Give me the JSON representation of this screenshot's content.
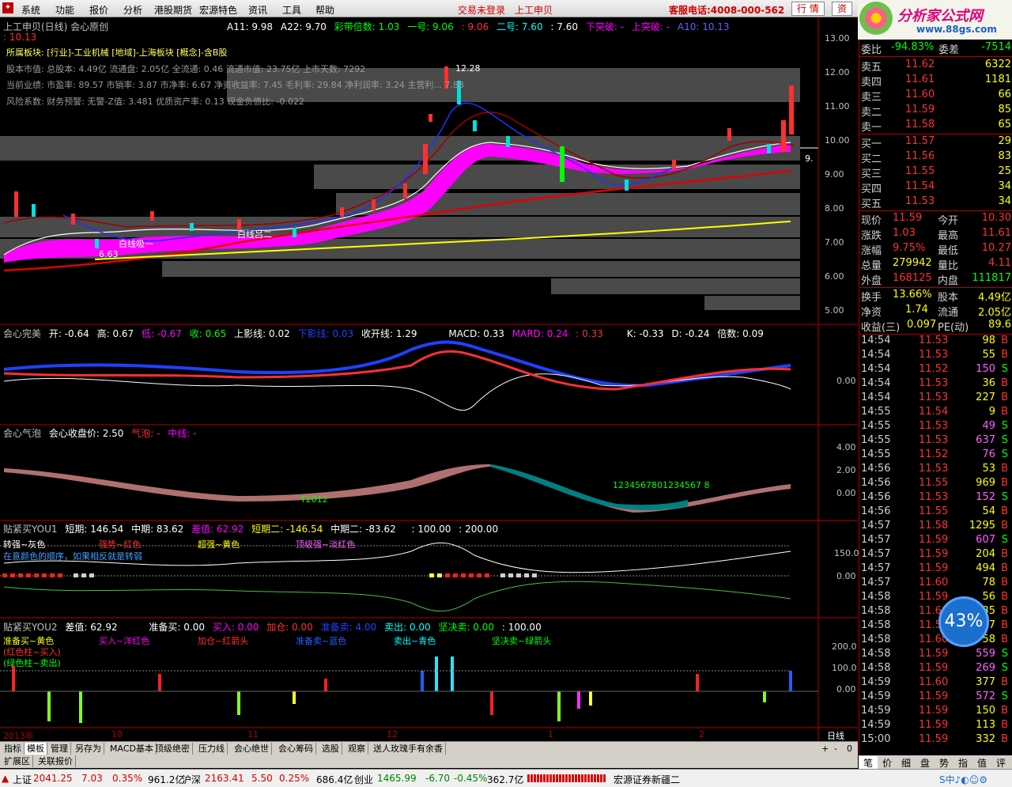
{
  "menu": {
    "items": [
      "系统",
      "功能",
      "报价",
      "分析",
      "港股期货",
      "宏源特色",
      "资讯",
      "工具",
      "帮助"
    ],
    "login": "交易未登录",
    "stock": "上工申贝",
    "hotline": "客服电话:4008-000-562",
    "btn1": "行 情",
    "btn2": "资"
  },
  "brand": {
    "title": "分析家公式网",
    "url": "www.88gs.com"
  },
  "main": {
    "title": "上工申贝(日线) 会心原创",
    "a11": "A11: 9.98",
    "a22": "A22: 9.70",
    "caidai": "彩带倍数: 1.03",
    "yihao": "一号: 9.06",
    "yihao2": ": 9.06",
    "erhao": "二号: 7.60",
    "erhao2": ": 7.60",
    "xiatupo": "下突破: -",
    "shangtupo": "上突破: -",
    "a10": "A10: 10.13",
    "val1013": ": 10.13",
    "info1": "所属板块: [行业]-工业机械 [地域]-上海板块 [概念]-含B股",
    "info2": "股本市值: 总股本: 4.49亿 流通盘: 2.05亿 全流通: 0.46 流通市值: 23.75亿 上市天数: 7292",
    "info3": "当前业绩: 市盈率: 89.57 市销率: 3.87 市净率: 6.67 净资收益率: 7.45 毛利率: 29.84 净利润率: 3.24 主营利... 7.88",
    "info4": "风险系数: 财务预警: 无警-Z值: 3.481 优质资产率: 0.13 现金负债比: -0.022",
    "hi": "12.28",
    "lo": "6.63",
    "ann1": "白线吸一",
    "ann2": "白线吕二",
    "lastprice": "9.",
    "yaxis": [
      "13.00",
      "12.00",
      "11.00",
      "10.00",
      "9.00",
      "8.00",
      "7.00",
      "6.00",
      "5.00"
    ]
  },
  "p2": {
    "name": "会心完美",
    "kai": "开: -0.64",
    "gao": "高: 0.67",
    "di": "低: -0.67",
    "shou": "收: 0.65",
    "syx": "上影线: 0.02",
    "xyx": "下影线: 0.03",
    "skx": "收开线: 1.29",
    "macd": "MACD: 0.33",
    "mard": "MARD: 0.24",
    "v033": ": 0.33",
    "k": "K: -0.33",
    "d": "D: -0.24",
    "bs": "倍数: 0.09",
    "y0": "0.00"
  },
  "p3": {
    "name": "会心气泡",
    "close": "会心收盘价: 2.50",
    "qp": "气泡: -",
    "zx": "中线: -",
    "y": [
      "4.00",
      "2.00",
      "0.00"
    ],
    "seq1": "T2012",
    "seq2": "1234567801234567 8"
  },
  "p4": {
    "name": "贴紧买YOU1",
    "dq": "短期: 146.54",
    "zq": "中期: 83.62",
    "cz": "差值: 62.92",
    "dq2": "短期二: -146.54",
    "zq2": "中期二: -83.62",
    "c100": ": 100.00",
    "c200": ": 200.00",
    "l1": "转强~灰色",
    "l2": "强势~红色",
    "l3": "超强~黄色",
    "l4": "顶级强~淡红色",
    "l5": "在意颜色的顺序，如果相反就是转弱",
    "y": [
      "150.0",
      "0.00"
    ]
  },
  "p5": {
    "name": "贴紧买YOU2",
    "cz": "差值: 62.92",
    "zbm": "准备买: 0.00",
    "mr": "买入: 0.00",
    "jc": "加仓: 0.00",
    "zbmc": "准备卖: 4.00",
    "mc": "卖出: 0.00",
    "jjm": "坚决卖: 0.00",
    "c100": ": 100.00",
    "l1": "准备买~黄色",
    "l2": "买入~洋红色",
    "l3": "加仓~红箭头",
    "l4": "准备卖~蓝色",
    "l5": "卖出~青色",
    "l6": "坚决卖~绿箭头",
    "l7": "(红色柱~买入)",
    "l8": "(绿色柱~卖出)",
    "y": [
      "200.0",
      "100.0",
      "0.00"
    ]
  },
  "xaxis": {
    "labels": [
      "2013年",
      "10",
      "11",
      "12",
      "1",
      "2"
    ],
    "mode": "日线"
  },
  "tabs": [
    "指标",
    "模板",
    "管理",
    "另存为",
    "MACD基本",
    "顶级绝密",
    "压力线",
    "会心绝世",
    "会心筹码",
    "选股",
    "观察",
    "送人玫瑰手有余香"
  ],
  "subtabs": [
    "扩展区",
    "关联报价"
  ],
  "quote": {
    "wb": "委比",
    "wbv": "-94.83%",
    "wc": "委差",
    "wcv": "-7514",
    "sell": [
      [
        "卖五",
        "11.62",
        "6322"
      ],
      [
        "卖四",
        "11.61",
        "1181"
      ],
      [
        "卖三",
        "11.60",
        "66"
      ],
      [
        "卖二",
        "11.59",
        "85"
      ],
      [
        "卖一",
        "11.58",
        "65"
      ]
    ],
    "buy": [
      [
        "买一",
        "11.57",
        "29"
      ],
      [
        "买二",
        "11.56",
        "83"
      ],
      [
        "买三",
        "11.55",
        "25"
      ],
      [
        "买四",
        "11.54",
        "34"
      ],
      [
        "买五",
        "11.53",
        "34"
      ]
    ],
    "stats": [
      [
        "现价",
        "11.59",
        "今开",
        "10.30"
      ],
      [
        "涨跌",
        "1.03",
        "最高",
        "11.61"
      ],
      [
        "涨幅",
        "9.75%",
        "最低",
        "10.27"
      ],
      [
        "总量",
        "279942",
        "量比",
        "4.11"
      ],
      [
        "外盘",
        "168125",
        "内盘",
        "111817"
      ]
    ],
    "stats2": [
      [
        "换手",
        "13.66%",
        "股本",
        "4.49亿"
      ],
      [
        "净资",
        "1.74",
        "流通",
        "2.05亿"
      ],
      [
        "收益(三)",
        "0.097",
        "PE(动)",
        "89.6"
      ]
    ]
  },
  "ticks": [
    [
      "14:54",
      "11.53",
      "98",
      "B"
    ],
    [
      "14:54",
      "11.53",
      "55",
      "B"
    ],
    [
      "14:54",
      "11.52",
      "150",
      "S"
    ],
    [
      "14:54",
      "11.53",
      "36",
      "B"
    ],
    [
      "14:54",
      "11.53",
      "227",
      "B"
    ],
    [
      "14:55",
      "11.54",
      "9",
      "B"
    ],
    [
      "14:55",
      "11.53",
      "49",
      "S"
    ],
    [
      "14:55",
      "11.53",
      "637",
      "S"
    ],
    [
      "14:55",
      "11.52",
      "76",
      "S"
    ],
    [
      "14:56",
      "11.53",
      "53",
      "B"
    ],
    [
      "14:56",
      "11.55",
      "969",
      "B"
    ],
    [
      "14:56",
      "11.53",
      "152",
      "S"
    ],
    [
      "14:56",
      "11.55",
      "54",
      "B"
    ],
    [
      "14:57",
      "11.58",
      "1295",
      "B"
    ],
    [
      "14:57",
      "11.59",
      "607",
      "S"
    ],
    [
      "14:57",
      "11.59",
      "204",
      "B"
    ],
    [
      "14:57",
      "11.59",
      "494",
      "B"
    ],
    [
      "14:57",
      "11.60",
      "78",
      "B"
    ],
    [
      "14:58",
      "11.59",
      "56",
      "B"
    ],
    [
      "14:58",
      "11.60",
      "35",
      "B"
    ],
    [
      "14:58",
      "11.59",
      "37",
      "B"
    ],
    [
      "14:58",
      "11.60",
      "58",
      "B"
    ],
    [
      "14:58",
      "11.59",
      "559",
      "S"
    ],
    [
      "14:58",
      "11.59",
      "269",
      "S"
    ],
    [
      "14:59",
      "11.60",
      "377",
      "B"
    ],
    [
      "14:59",
      "11.59",
      "572",
      "S"
    ],
    [
      "14:59",
      "11.59",
      "150",
      "B"
    ],
    [
      "14:59",
      "11.59",
      "113",
      "B"
    ],
    [
      "15:00",
      "11.59",
      "332",
      "B"
    ]
  ],
  "rtabs": [
    "笔",
    "价",
    "细",
    "盘",
    "势",
    "指",
    "值",
    "评"
  ],
  "status": {
    "sh": "上证",
    "shv": "2041.25",
    "shc": "7.03",
    "shp": "0.35%",
    "shamt": "961.2亿",
    "sz": "沪深",
    "szv": "2163.41",
    "szc": "5.50",
    "szp": "0.25%",
    "szamt": "686.4亿",
    "cy": "创业",
    "cyv": "1465.99",
    "cyc": "-6.70",
    "cyp": "-0.45%",
    "cyamt": "362.7亿",
    "broker": "宏源证券新疆二"
  },
  "circle": "43%"
}
